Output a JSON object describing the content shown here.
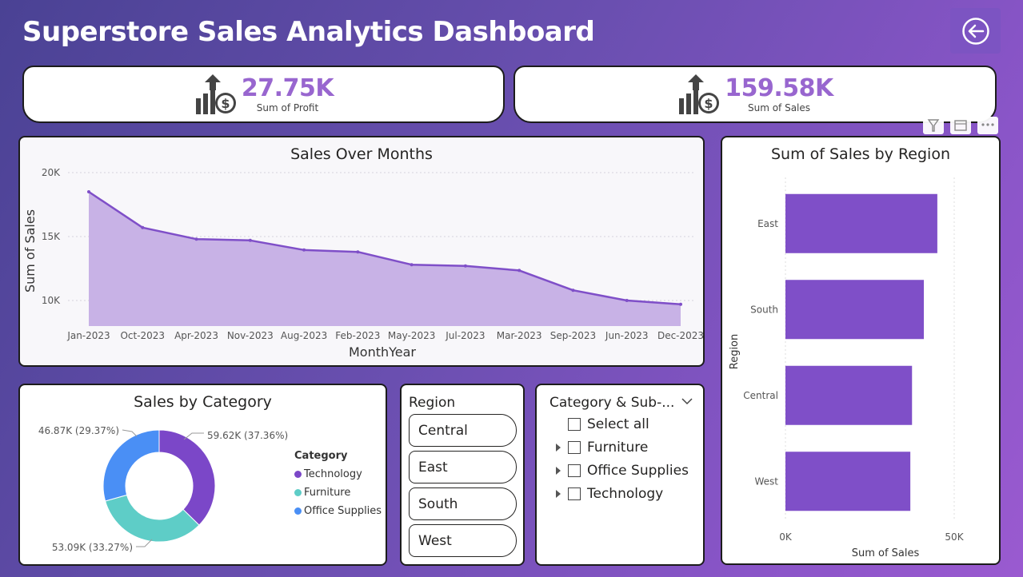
{
  "header": {
    "title": "Superstore Sales Analytics Dashboard"
  },
  "kpis": {
    "profit": {
      "value": "27.75K",
      "label": "Sum of Profit"
    },
    "sales": {
      "value": "159.58K",
      "label": "Sum of Sales"
    }
  },
  "line_chart": {
    "title": "Sales Over Months",
    "xlabel": "MonthYear",
    "ylabel": "Sum of Sales",
    "yticks": [
      "10K",
      "15K",
      "20K"
    ],
    "color": "#7f4fc8",
    "fill": "#c8b2e6"
  },
  "region_chart": {
    "title": "Sum of Sales by Region",
    "xlabel": "Sum of Sales",
    "ylabel": "Region",
    "xticks": [
      "0K",
      "50K"
    ],
    "color": "#7f4fc8"
  },
  "category_chart": {
    "title": "Sales by Category",
    "legend_title": "Category",
    "labels": [
      "59.62K (37.36%)",
      "53.09K (33.27%)",
      "46.87K (29.37%)"
    ],
    "legend": [
      {
        "name": "Technology",
        "color": "#7b47c8"
      },
      {
        "name": "Furniture",
        "color": "#5ecdc7"
      },
      {
        "name": "Office Supplies",
        "color": "#4a8ff5"
      }
    ]
  },
  "region_slicer": {
    "title": "Region",
    "options": [
      "Central",
      "East",
      "South",
      "West"
    ]
  },
  "category_slicer": {
    "title": "Category & Sub-...",
    "select_all": "Select all",
    "items": [
      "Furniture",
      "Office Supplies",
      "Technology"
    ]
  },
  "chart_data": [
    {
      "type": "area",
      "title": "Sales Over Months",
      "xlabel": "MonthYear",
      "ylabel": "Sum of Sales",
      "categories": [
        "Jan-2023",
        "Oct-2023",
        "Apr-2023",
        "Nov-2023",
        "Aug-2023",
        "Feb-2023",
        "May-2023",
        "Jul-2023",
        "Mar-2023",
        "Sep-2023",
        "Jun-2023",
        "Dec-2023"
      ],
      "values": [
        18500,
        15700,
        14800,
        14700,
        13950,
        13800,
        12800,
        12700,
        12350,
        10800,
        10000,
        9700
      ],
      "ylim": [
        8000,
        20000
      ],
      "grid": true
    },
    {
      "type": "bar",
      "orientation": "horizontal",
      "title": "Sum of Sales by Region",
      "xlabel": "Sum of Sales",
      "ylabel": "Region",
      "categories": [
        "East",
        "South",
        "Central",
        "West"
      ],
      "values": [
        45000,
        41000,
        37500,
        37000
      ],
      "xlim": [
        0,
        50000
      ]
    },
    {
      "type": "pie",
      "title": "Sales by Category",
      "categories": [
        "Technology",
        "Furniture",
        "Office Supplies"
      ],
      "values": [
        59620,
        53090,
        46870
      ],
      "percents": [
        37.36,
        33.27,
        29.37
      ],
      "donut": true
    }
  ]
}
